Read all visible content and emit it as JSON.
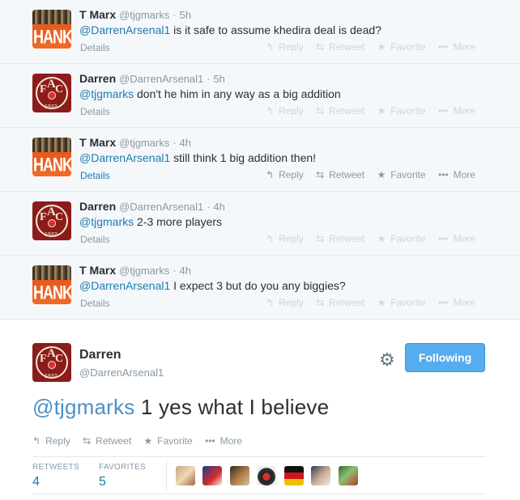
{
  "tweets": [
    {
      "name": "T Marx",
      "handle": "@tjgmarks",
      "time": "5h",
      "mention": "@DarrenArsenal1",
      "body": "is it safe to assume khedira deal is dead?",
      "avatar": "hanks"
    },
    {
      "name": "Darren",
      "handle": "@DarrenArsenal1",
      "time": "5h",
      "mention": "@tjgmarks",
      "body": "don't he him in any way as a big addition",
      "avatar": "fac"
    },
    {
      "name": "T Marx",
      "handle": "@tjgmarks",
      "time": "4h",
      "mention": "@DarrenArsenal1",
      "body": "still think 1 big addition then!",
      "avatar": "hanks"
    },
    {
      "name": "Darren",
      "handle": "@DarrenArsenal1",
      "time": "4h",
      "mention": "@tjgmarks",
      "body": "2-3 more players",
      "avatar": "fac"
    },
    {
      "name": "T Marx",
      "handle": "@tjgmarks",
      "time": "4h",
      "mention": "@DarrenArsenal1",
      "body": "I expect 3 but do you any biggies?",
      "avatar": "hanks"
    }
  ],
  "labels": {
    "details": "Details",
    "reply": "Reply",
    "retweet": "Retweet",
    "favorite": "Favorite",
    "more": "More",
    "sep": "·"
  },
  "avatar_text": {
    "hanks": "HANKS",
    "fac_f": "F",
    "fac_a": "A",
    "fac_c": "C",
    "fac_year": "1932"
  },
  "main": {
    "name": "Darren",
    "handle": "@DarrenArsenal1",
    "follow_label": "Following",
    "mention": "@tjgmarks",
    "body": "1 yes what I believe",
    "retweets_label": "RETWEETS",
    "retweets": "4",
    "favorites_label": "FAVORITES",
    "favorites": "5"
  },
  "icons": {
    "reply": "reply-icon",
    "retweet": "retweet-icon",
    "favorite": "star-icon",
    "more": "ellipsis-icon",
    "settings": "gear-icon"
  },
  "colors": {
    "link": "#1b7ab3",
    "follow_button": "#55acee",
    "conversation_bg": "#f5f8fa"
  }
}
